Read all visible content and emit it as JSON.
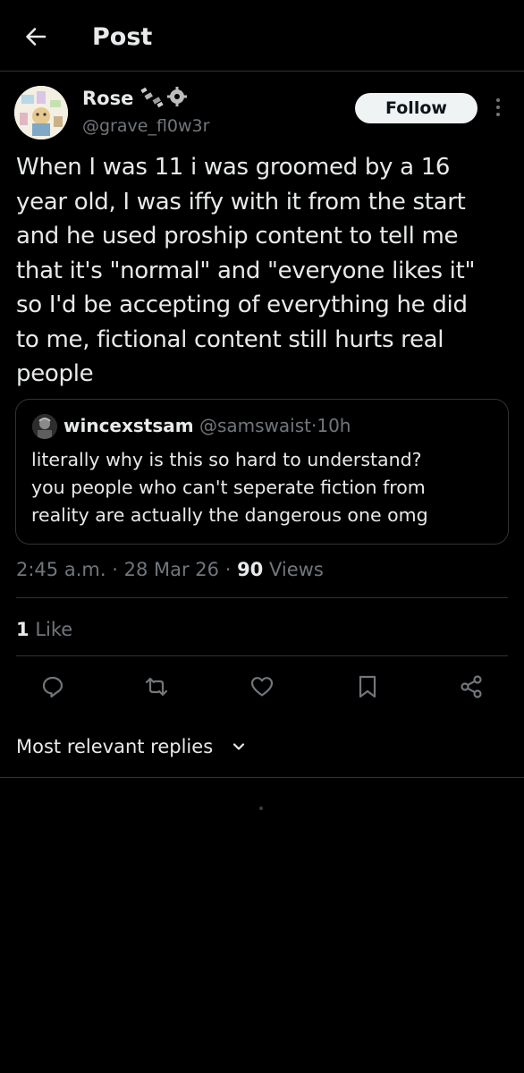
{
  "header": {
    "title": "Post"
  },
  "author": {
    "display_name": "Rose",
    "handle": "@grave_fl0w3r"
  },
  "follow_label": "Follow",
  "post": {
    "text": "When I was 11 i was groomed by a 16\nyear old, I was iffy with it from the start\nand he used proship content to tell me\nthat it's \"normal\" and \"everyone likes it\"\nso I'd be accepting of everything he did\nto me, fictional content still hurts real\npeople"
  },
  "quote": {
    "name": "wincexstsam",
    "handle": "@samswaist",
    "separator": "·",
    "time": "10h",
    "text": "literally why is this so hard to understand?\nyou people who can't seperate fiction from\nreality are actually the dangerous one omg"
  },
  "meta": {
    "time": "2:45 a.m.",
    "date": "28 Mar 26",
    "separator": "·",
    "views_count": "90",
    "views_label": "Views"
  },
  "likes": {
    "count": "1",
    "label": "Like"
  },
  "actions": [
    "reply-icon",
    "repost-icon",
    "like-icon",
    "bookmark-icon",
    "share-icon"
  ],
  "replies_sort_label": "Most relevant replies",
  "colors": {
    "background": "#000000",
    "text": "#e7e9ea",
    "muted": "#71767b",
    "border": "#2f3336",
    "follow_bg": "#eff3f4"
  }
}
